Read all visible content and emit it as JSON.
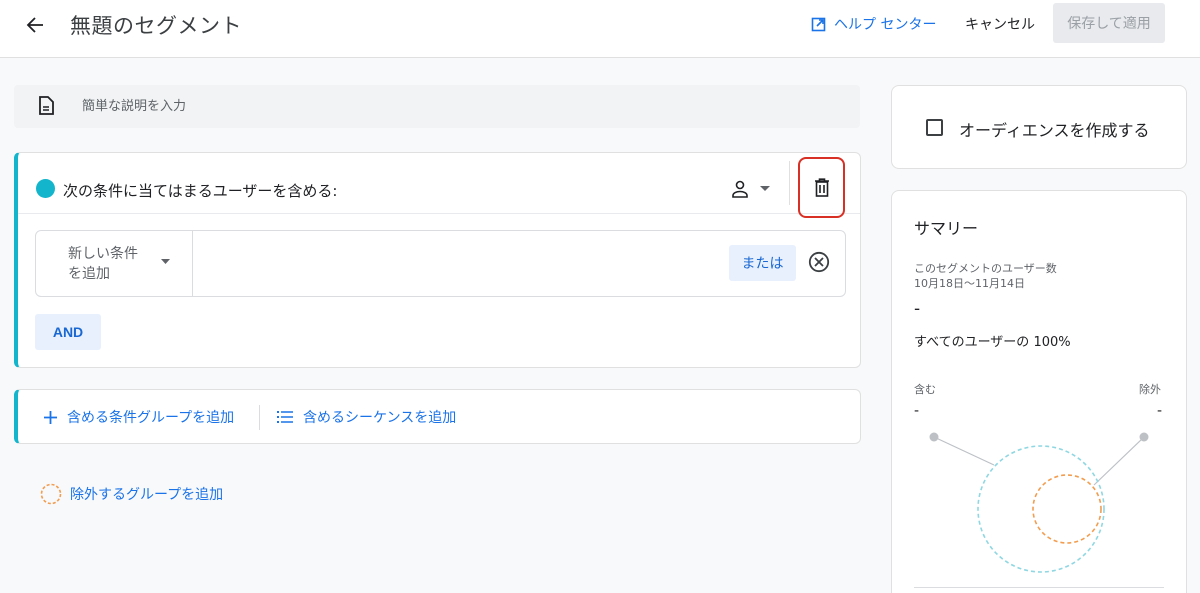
{
  "header": {
    "title": "無題のセグメント",
    "help_label": "ヘルプ センター",
    "cancel_label": "キャンセル",
    "save_label": "保存して適用"
  },
  "description": {
    "placeholder": "簡単な説明を入力",
    "value": ""
  },
  "include_group": {
    "title": "次の条件に当てはまるユーザーを含める:",
    "accent_color": "#12b5cb",
    "scope_icon": "person-icon",
    "condition": {
      "dropdown_label": "新しい条件を追加",
      "or_label": "または"
    },
    "and_label": "AND"
  },
  "add_bar": {
    "add_condition_group": "含める条件グループを追加",
    "add_sequence": "含めるシーケンスを追加"
  },
  "exclude_link": "除外するグループを追加",
  "audience": {
    "label": "オーディエンスを作成する",
    "checked": false
  },
  "summary": {
    "title": "サマリー",
    "users_label": "このセグメントのユーザー数",
    "date_range": "10月18日〜11月14日",
    "count": "-",
    "percent_text": "すべてのユーザーの 100%",
    "include_label": "含む",
    "exclude_label": "除外",
    "include_value": "-",
    "exclude_value": "-"
  },
  "colors": {
    "accent_blue": "#1a73e8",
    "teal": "#12b5cb",
    "exclude_orange": "#f29d50",
    "highlight_red": "#d93025"
  }
}
